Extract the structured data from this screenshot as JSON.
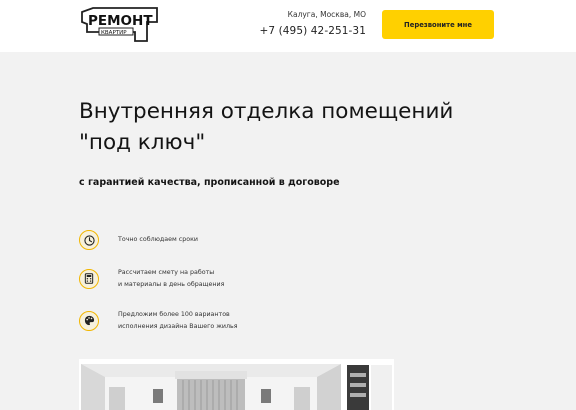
{
  "header": {
    "logo_text": "РЕМОНТ",
    "logo_sub": "КВАРТИР",
    "city": "Калуга, Москва, МО",
    "phone": "+7 (495) 42-251-31",
    "callback_label": "Перезвоните мне"
  },
  "hero": {
    "title_line1": "Внутренняя отделка помещений",
    "title_line2": "\"под ключ\"",
    "subtitle": "с гарантией качества, прописанной в договоре"
  },
  "features": [
    {
      "icon": "clock-icon",
      "line1": "Точно соблюдаем сроки",
      "line2": ""
    },
    {
      "icon": "calculator-icon",
      "line1": "Рассчитаем смету на работы",
      "line2": "и материалы в день обращения"
    },
    {
      "icon": "palette-icon",
      "line1": "Предложим более 100 вариантов",
      "line2": "исполнения дизайна Вашего жилья"
    }
  ],
  "colors": {
    "accent": "#ffd000",
    "icon_ring": "#f2b600",
    "hero_background": "#f2f2f2"
  }
}
